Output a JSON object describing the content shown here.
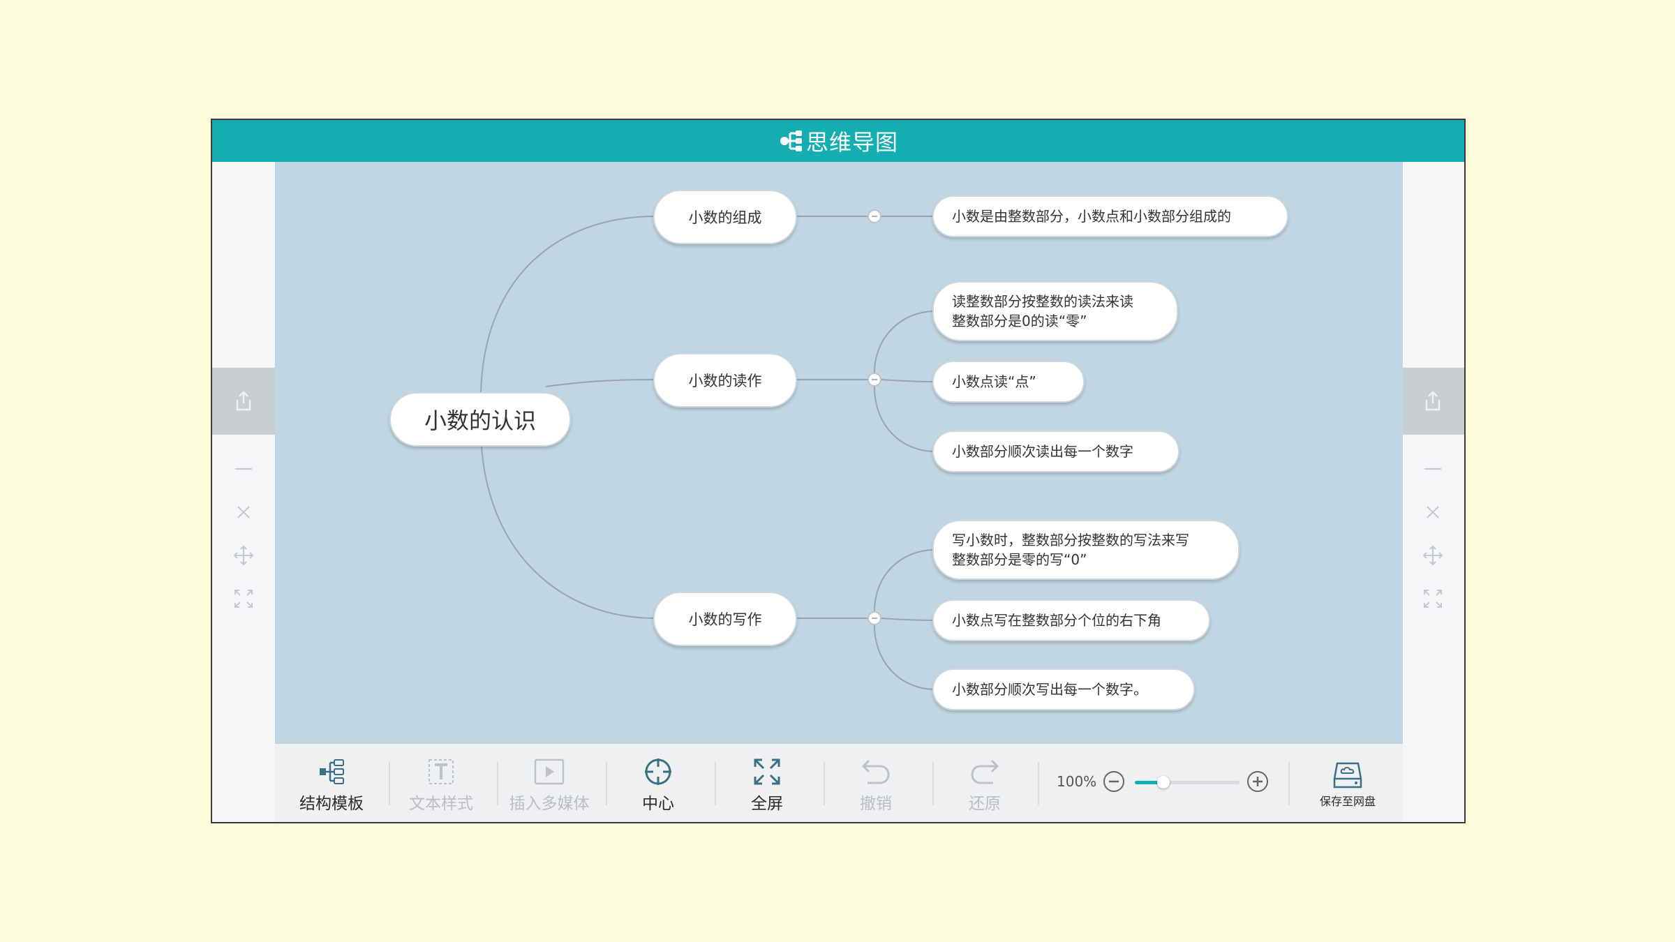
{
  "app": {
    "title": "思维导图"
  },
  "colors": {
    "accent": "#14aeb2",
    "canvas_bg": "#c0d6e4",
    "page_bg": "#fdfcd9"
  },
  "mindmap": {
    "root": "小数的认识",
    "branches": [
      {
        "label": "小数的组成",
        "children": [
          [
            "小数是由整数部分，小数点和小数部分组成的"
          ]
        ]
      },
      {
        "label": "小数的读作",
        "children": [
          [
            "读整数部分按整数的读法来读",
            "整数部分是0的读“零”"
          ],
          [
            "小数点读“点”"
          ],
          [
            "小数部分顺次读出每一个数字"
          ]
        ]
      },
      {
        "label": "小数的写作",
        "children": [
          [
            "写小数时，整数部分按整数的写法来写",
            "整数部分是零的写“0”"
          ],
          [
            "小数点写在整数部分个位的右下角"
          ],
          [
            "小数部分顺次写出每一个数字。"
          ]
        ]
      }
    ]
  },
  "side_toolbar": {
    "icons": [
      "share-icon",
      "minus-icon",
      "close-icon",
      "move-icon",
      "fit-screen-icon"
    ]
  },
  "toolbar": {
    "structure_template": "结构模板",
    "text_style": "文本样式",
    "insert_media": "插入多媒体",
    "center": "中心",
    "fullscreen": "全屏",
    "undo": "撤销",
    "redo": "还原",
    "zoom_level": "100%",
    "zoom_fraction": 0.27,
    "save_to_disk": "保存至网盘"
  }
}
